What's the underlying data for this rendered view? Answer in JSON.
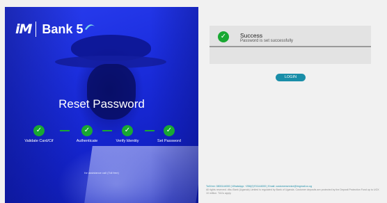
{
  "brand": {
    "logo_mark": "iM",
    "name": "Bank 5",
    "colors": {
      "hero_blue": "#1c2fe0",
      "success_green": "#19a832",
      "accent_teal": "#1a8ea8"
    }
  },
  "hero": {
    "title": "Reset Password",
    "steps": [
      {
        "label": "Validate Card/Cif",
        "state": "complete",
        "icon": "check-icon"
      },
      {
        "label": "Authenticate",
        "state": "complete",
        "icon": "check-icon"
      },
      {
        "label": "Verify Identity",
        "state": "complete",
        "icon": "check-icon"
      },
      {
        "label": "Set Password",
        "state": "complete",
        "icon": "check-icon"
      }
    ],
    "assistance_text": "for assistance call (Toll free)"
  },
  "alert": {
    "icon": "check-icon",
    "title": "Success",
    "message": "Password is set successfully"
  },
  "login_button": {
    "label": "LOGIN"
  },
  "footer": {
    "contact": "Toll free: 0800144000 | WhatsApp: +256(0)701144000 | Email: customerservice@imgmail.co.ug",
    "legal": "All rights reserved. dfcu Bank (Uganda) Limited is regulated by Bank of Uganda. Customer deposits are protected by the Deposit Protection Fund up to UGX 10 million. T&Cs apply."
  }
}
